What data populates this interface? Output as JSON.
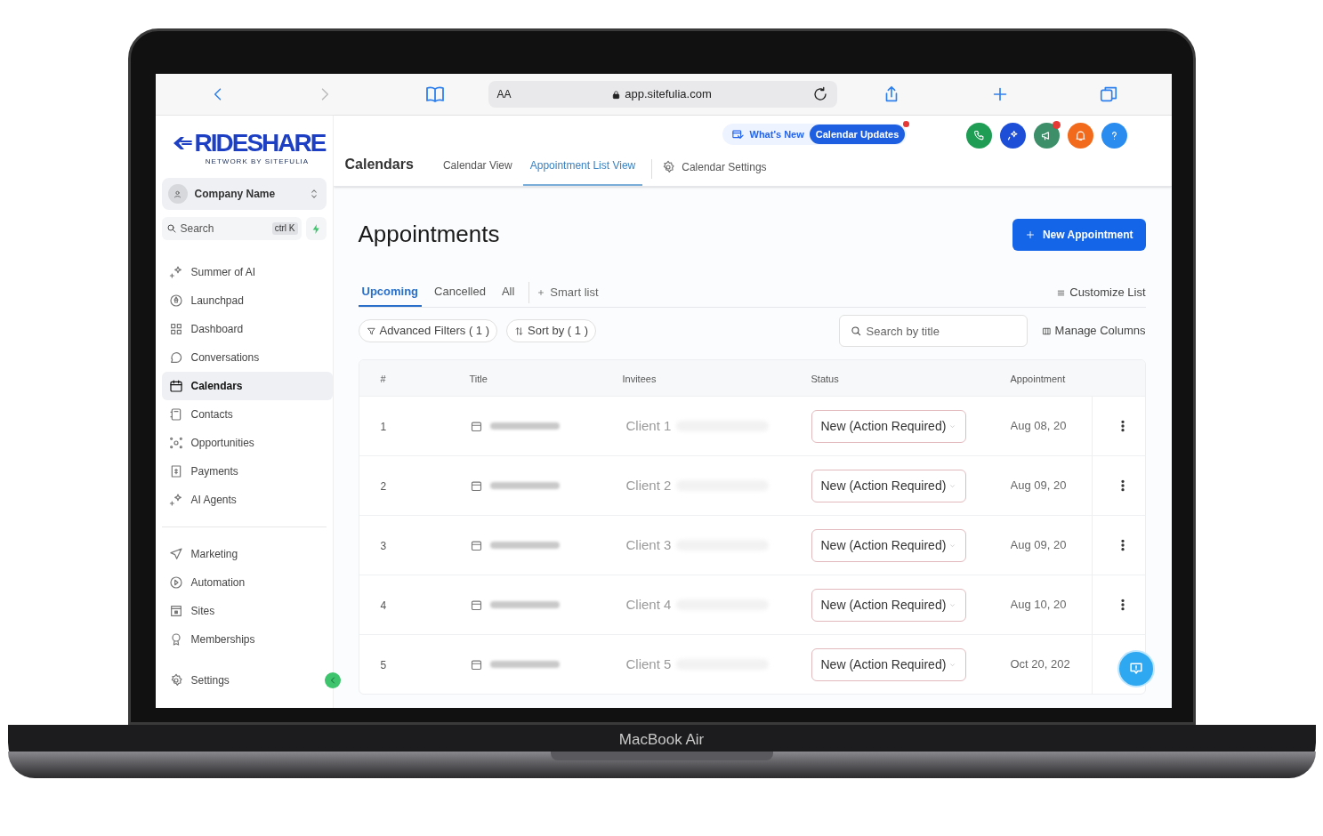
{
  "device": {
    "label": "MacBook Air"
  },
  "browser": {
    "reader": "AA",
    "url": "app.sitefulia.com"
  },
  "logo": {
    "name": "RIDESHARE",
    "tagline": "NETWORK BY SITEFULIA"
  },
  "sidebar": {
    "account": "Company Name",
    "search": {
      "placeholder": "Search",
      "shortcut": "ctrl K"
    },
    "groups": [
      [
        {
          "label": "Summer of AI",
          "selected": false
        },
        {
          "label": "Launchpad",
          "selected": false
        },
        {
          "label": "Dashboard",
          "selected": false
        },
        {
          "label": "Conversations",
          "selected": false
        },
        {
          "label": "Calendars",
          "selected": true
        },
        {
          "label": "Contacts",
          "selected": false
        },
        {
          "label": "Opportunities",
          "selected": false
        },
        {
          "label": "Payments",
          "selected": false
        },
        {
          "label": "AI Agents",
          "selected": false
        }
      ],
      [
        {
          "label": "Marketing",
          "selected": false
        },
        {
          "label": "Automation",
          "selected": false
        },
        {
          "label": "Sites",
          "selected": false
        },
        {
          "label": "Memberships",
          "selected": false
        }
      ],
      [
        {
          "label": "Settings",
          "selected": false
        }
      ]
    ]
  },
  "header": {
    "title": "Calendars",
    "tabs": [
      {
        "label": "Calendar View",
        "selected": false
      },
      {
        "label": "Appointment List View",
        "selected": true
      }
    ],
    "settings": "Calendar Settings",
    "whats_new": "What's New",
    "updates": "Calendar Updates"
  },
  "page": {
    "title": "Appointments",
    "new_button": "New Appointment",
    "list_tabs": [
      {
        "label": "Upcoming",
        "selected": true
      },
      {
        "label": "Cancelled",
        "selected": false
      },
      {
        "label": "All",
        "selected": false
      }
    ],
    "smart_list": "Smart list",
    "customize": "Customize List",
    "filters": "Advanced Filters ( 1 )",
    "sort": "Sort by ( 1 )",
    "search": {
      "placeholder": "Search by title"
    },
    "manage_columns": "Manage Columns"
  },
  "table": {
    "columns": [
      "#",
      "Title",
      "Invitees",
      "Status",
      "Appointment"
    ],
    "rows": [
      {
        "number": "1",
        "invitee": "Client 1",
        "status": "New (Action Required)",
        "date": "Aug 08, 20"
      },
      {
        "number": "2",
        "invitee": "Client 2",
        "status": "New (Action Required)",
        "date": "Aug 09, 20"
      },
      {
        "number": "3",
        "invitee": "Client 3",
        "status": "New (Action Required)",
        "date": "Aug 09, 20"
      },
      {
        "number": "4",
        "invitee": "Client 4",
        "status": "New (Action Required)",
        "date": "Aug 10, 20"
      },
      {
        "number": "5",
        "invitee": "Client 5",
        "status": "New (Action Required)",
        "date": "Oct 20, 202"
      }
    ]
  }
}
